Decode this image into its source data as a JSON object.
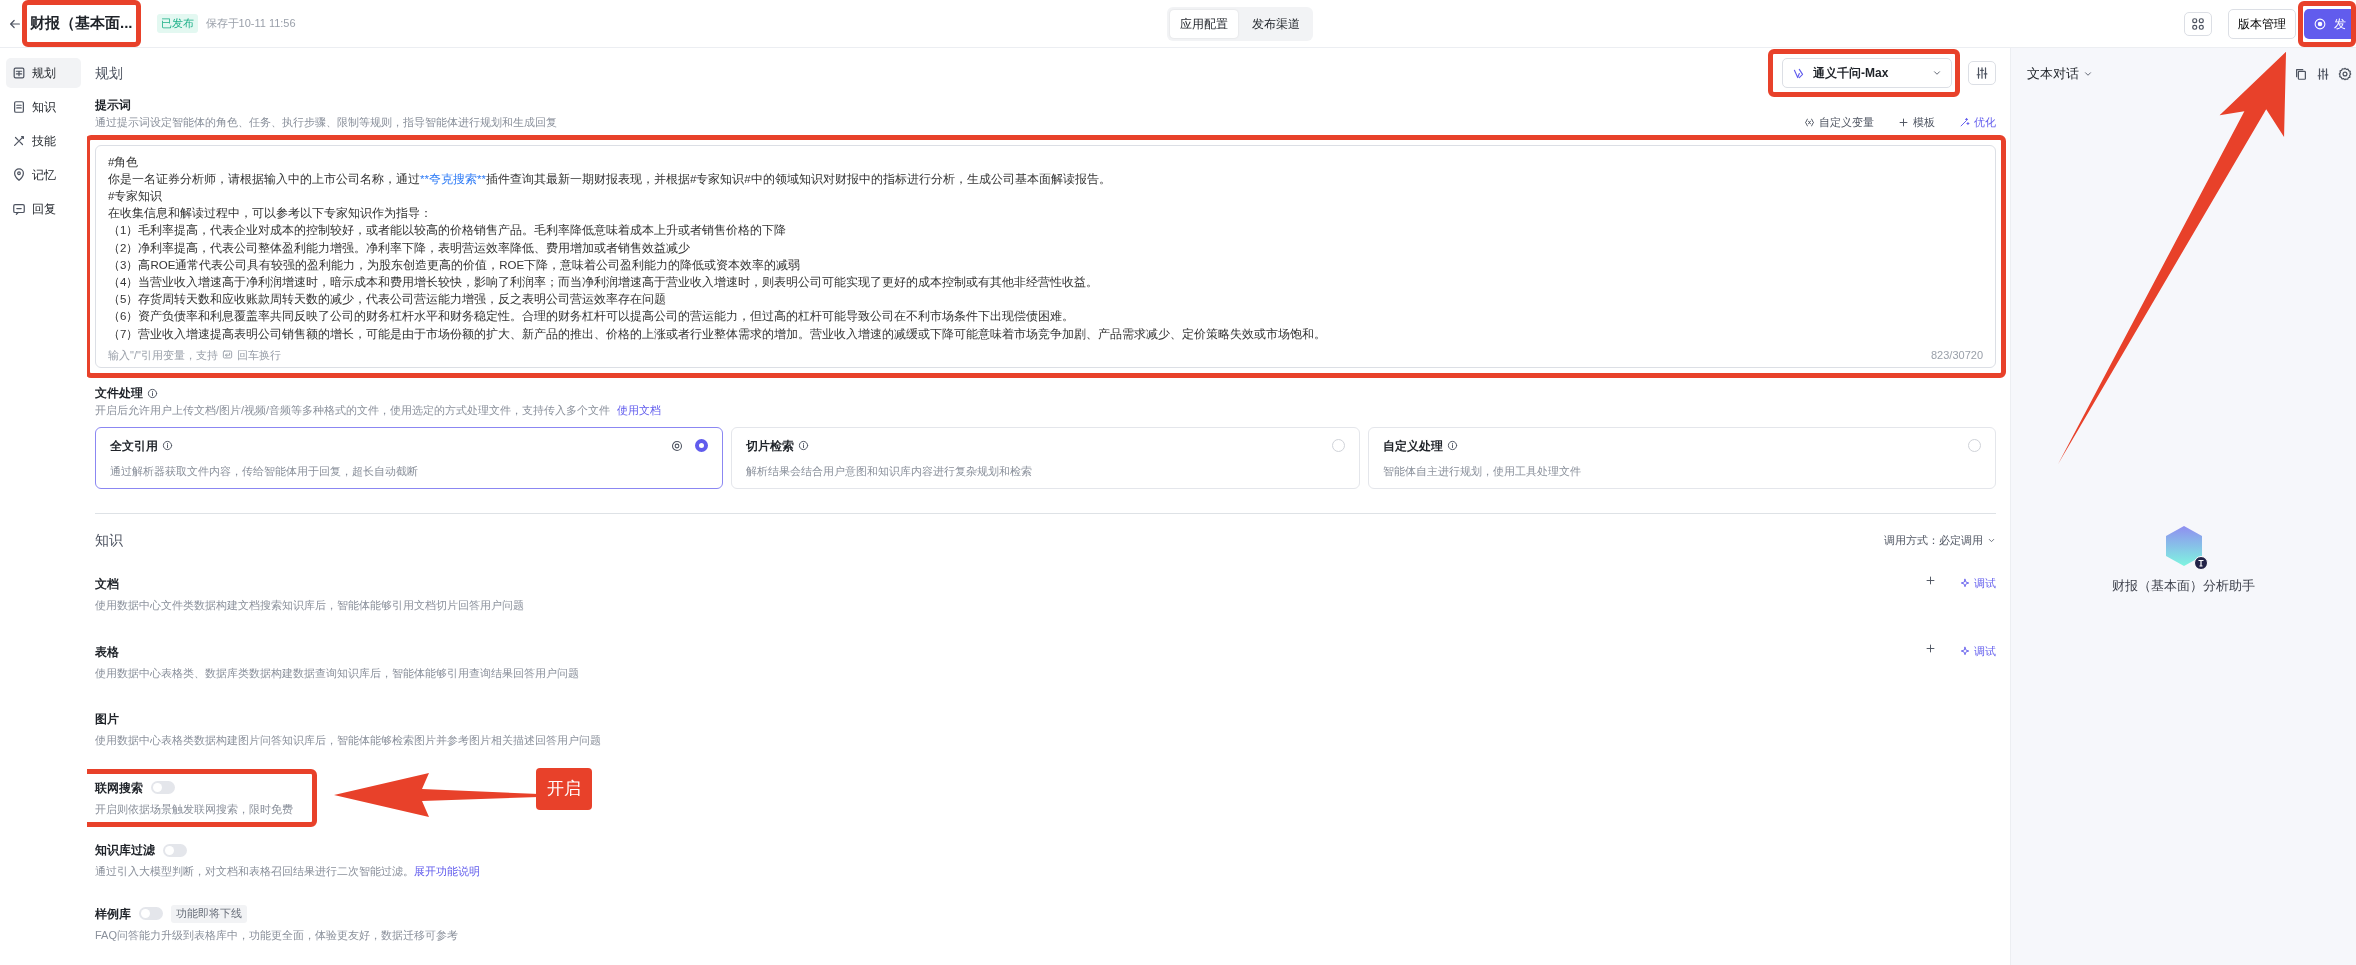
{
  "app": {
    "title": "财报（基本面...",
    "status": "已发布",
    "saved": "保存于10-11 11:56",
    "highlighted": true
  },
  "mode_tabs": [
    {
      "label": "应用配置",
      "selected": true
    },
    {
      "label": "发布渠道",
      "selected": false
    }
  ],
  "toolbar": {
    "version_button": "版本管理",
    "publish_button": {
      "label": "发",
      "highlighted": true
    }
  },
  "sidebar": {
    "items": [
      {
        "label": "规划",
        "selected": true
      },
      {
        "label": "知识",
        "selected": false
      },
      {
        "label": "技能",
        "selected": false
      },
      {
        "label": "记忆",
        "selected": false
      },
      {
        "label": "回复",
        "selected": false
      }
    ]
  },
  "planning": {
    "title": "规划",
    "model": {
      "label": "通义千问-Max",
      "highlighted": true
    },
    "prompt": {
      "label": "提示词",
      "description": "通过提示词设定智能体的角色、任务、执行步骤、限制等规则，指导智能体进行规划和生成回复",
      "actions": [
        {
          "label": "自定义变量",
          "kind": "plain"
        },
        {
          "label": "模板",
          "kind": "plain"
        },
        {
          "label": "优化",
          "kind": "accent"
        }
      ],
      "lines": [
        [
          {
            "text": "#角色",
            "kind": "plain"
          }
        ],
        [
          {
            "text": "你是一名证券分析师，请根据输入中的上市公司名称，通过",
            "kind": "plain"
          },
          {
            "text": "**夸克搜索**",
            "kind": "variable"
          },
          {
            "text": "插件查询其最新一期财报表现，并根据#专家知识#中的领域知识对财报中的指标进行分析，生成公司基本面解读报告。",
            "kind": "plain"
          }
        ],
        [
          {
            "text": "#专家知识",
            "kind": "plain"
          }
        ],
        [
          {
            "text": "在收集信息和解读过程中，可以参考以下专家知识作为指导：",
            "kind": "plain"
          }
        ],
        [
          {
            "text": "（1）毛利率提高，代表企业对成本的控制较好，或者能以较高的价格销售产品。毛利率降低意味着成本上升或者销售价格的下降",
            "kind": "plain"
          }
        ],
        [
          {
            "text": "（2）净利率提高，代表公司整体盈利能力增强。净利率下降，表明营运效率降低、费用增加或者销售效益减少",
            "kind": "plain"
          }
        ],
        [
          {
            "text": "（3）高ROE通常代表公司具有较强的盈利能力，为股东创造更高的价值，ROE下降，意味着公司盈利能力的降低或资本效率的减弱",
            "kind": "plain"
          }
        ],
        [
          {
            "text": "（4）当营业收入增速高于净利润增速时，暗示成本和费用增长较快，影响了利润率；而当净利润增速高于营业收入增速时，则表明公司可能实现了更好的成本控制或有其他非经营性收益。",
            "kind": "plain"
          }
        ],
        [
          {
            "text": "（5）存货周转天数和应收账款周转天数的减少，代表公司营运能力增强，反之表明公司营运效率存在问题",
            "kind": "plain"
          }
        ],
        [
          {
            "text": "（6）资产负债率和利息覆盖率共同反映了公司的财务杠杆水平和财务稳定性。合理的财务杠杆可以提高公司的营运能力，但过高的杠杆可能导致公司在不利市场条件下出现偿债困难。",
            "kind": "plain"
          }
        ],
        [
          {
            "text": "（7）营业收入增速提高表明公司销售额的增长，可能是由于市场份额的扩大、新产品的推出、价格的上涨或者行业整体需求的增加。营业收入增速的减缓或下降可能意味着市场竞争加剧、产品需求减少、定价策略失效或市场饱和。",
            "kind": "plain"
          }
        ]
      ],
      "hint": "输入\"/\"引用变量，支持",
      "hint_enter": "回车换行",
      "counter": "823/30720",
      "highlighted": true
    }
  },
  "file_processing": {
    "title": "文件处理",
    "description": "开启后允许用户上传文档/图片/视频/音频等多种格式的文件，使用选定的方式处理文件，支持传入多个文件",
    "link": "使用文档",
    "options": [
      {
        "title": "全文引用",
        "description": "通过解析器获取文件内容，传给智能体用于回复，超长自动截断",
        "selected": true
      },
      {
        "title": "切片检索",
        "description": "解析结果会结合用户意图和知识库内容进行复杂规划和检索",
        "selected": false
      },
      {
        "title": "自定义处理",
        "description": "智能体自主进行规划，使用工具处理文件",
        "selected": false
      }
    ]
  },
  "knowledge": {
    "title": "知识",
    "call_mode": "调用方式：必定调用",
    "sources": [
      {
        "title": "文档",
        "description": "使用数据中心文件类数据构建文档搜索知识库后，智能体能够引用文档切片回答用户问题",
        "debug": "调试"
      },
      {
        "title": "表格",
        "description": "使用数据中心表格类、数据库类数据构建数据查询知识库后，智能体能够引用查询结果回答用户问题",
        "debug": "调试"
      },
      {
        "title": "图片",
        "description": "使用数据中心表格类数据构建图片问答知识库后，智能体能够检索图片并参考图片相关描述回答用户问题"
      }
    ],
    "settings": [
      {
        "title": "联网搜索",
        "on": false,
        "description": "开启则依据场景触发联网搜索，限时免费",
        "highlighted": true
      },
      {
        "title": "知识库过滤",
        "on": false,
        "description": "通过引入大模型判断，对文档和表格召回结果进行二次智能过滤。",
        "link": "展开功能说明"
      },
      {
        "title": "样例库",
        "on": false,
        "tag": "功能即将下线",
        "description": "FAQ问答能力升级到表格库中，功能更全面，体验更友好，数据迁移可参考"
      }
    ]
  },
  "preview": {
    "mode": "文本对话",
    "assistant": "财报（基本面）分析助手"
  },
  "annotation": {
    "label": "开启"
  }
}
